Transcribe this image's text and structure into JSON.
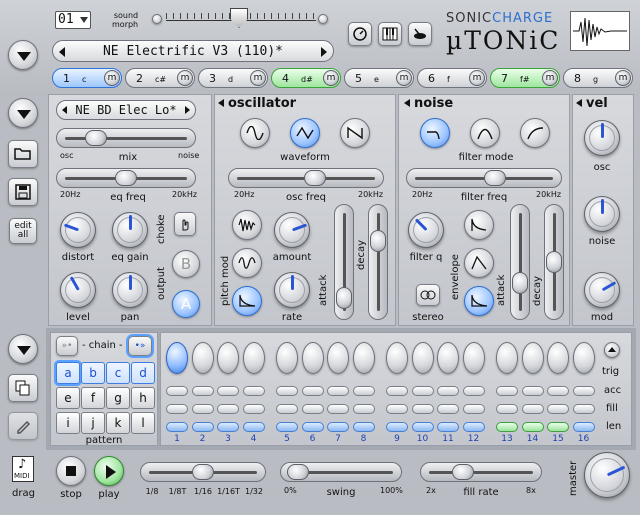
{
  "header": {
    "pattern_select": "01",
    "sound_morph_label": "sound\nmorph",
    "brand_top_a": "SONIC",
    "brand_top_b": "CHARGE",
    "brand_main": "µTONiC",
    "preset_name": "NE Electrific V3 (110)*"
  },
  "channels": [
    {
      "num": "1",
      "note": "c",
      "mute": "m",
      "state": "selected"
    },
    {
      "num": "2",
      "note": "c#",
      "mute": "m",
      "state": "normal"
    },
    {
      "num": "3",
      "note": "d",
      "mute": "m",
      "state": "normal"
    },
    {
      "num": "4",
      "note": "d#",
      "mute": "m",
      "state": "green"
    },
    {
      "num": "5",
      "note": "e",
      "mute": "m",
      "state": "normal"
    },
    {
      "num": "6",
      "note": "f",
      "mute": "m",
      "state": "normal"
    },
    {
      "num": "7",
      "note": "f#",
      "mute": "m",
      "state": "green"
    },
    {
      "num": "8",
      "note": "g",
      "mute": "m",
      "state": "normal"
    }
  ],
  "sidebar": {
    "edit_all": "edit\nall",
    "midi_label": "MIDI",
    "drag_label": "drag"
  },
  "mixer": {
    "patch_name": "NE BD Elec Lo*",
    "mix_label": "mix",
    "mix_left": "osc",
    "mix_right": "noise",
    "eq_freq_label": "eq freq",
    "eq_freq_min": "20Hz",
    "eq_freq_max": "20kHz",
    "distort_label": "distort",
    "eq_gain_label": "eq gain",
    "level_label": "level",
    "pan_label": "pan",
    "choke_label": "choke",
    "output_label": "output",
    "out_b": "B",
    "out_a": "A"
  },
  "oscillator": {
    "title": "oscillator",
    "waveform_label": "waveform",
    "osc_freq_label": "osc freq",
    "osc_freq_min": "20Hz",
    "osc_freq_max": "20kHz",
    "pitch_mod_label": "pitch mod",
    "amount_label": "amount",
    "rate_label": "rate",
    "attack_label": "attack",
    "decay_label": "decay"
  },
  "noise": {
    "title": "noise",
    "filter_mode_label": "filter mode",
    "filter_freq_label": "filter freq",
    "filter_freq_min": "20Hz",
    "filter_freq_max": "20kHz",
    "filter_q_label": "filter q",
    "envelope_label": "envelope",
    "stereo_label": "stereo",
    "attack_label": "attack",
    "decay_label": "decay"
  },
  "vel": {
    "title": "vel",
    "osc_label": "osc",
    "noise_label": "noise",
    "mod_label": "mod"
  },
  "sequencer": {
    "chain_label": "- chain -",
    "pattern_label": "pattern",
    "patterns": [
      "a",
      "b",
      "c",
      "d",
      "e",
      "f",
      "g",
      "h",
      "i",
      "j",
      "k",
      "l"
    ],
    "steps": [
      "1",
      "2",
      "3",
      "4",
      "5",
      "6",
      "7",
      "8",
      "9",
      "10",
      "11",
      "12",
      "13",
      "14",
      "15",
      "16"
    ],
    "trig_label": "trig",
    "acc_label": "acc",
    "fill_label": "fill",
    "len_label": "len"
  },
  "transport": {
    "stop_label": "stop",
    "play_label": "play",
    "rate_ticks": [
      "1/8",
      "1/8T",
      "1/16",
      "1/16T",
      "1/32"
    ],
    "swing_label": "swing",
    "swing_min": "0%",
    "swing_max": "100%",
    "fill_rate_label": "fill rate",
    "fill_rate_min": "2x",
    "fill_rate_max": "8x",
    "master_label": "master"
  },
  "colors": {
    "accent_blue": "#2d72d9",
    "accent_green": "#3aa23a"
  }
}
